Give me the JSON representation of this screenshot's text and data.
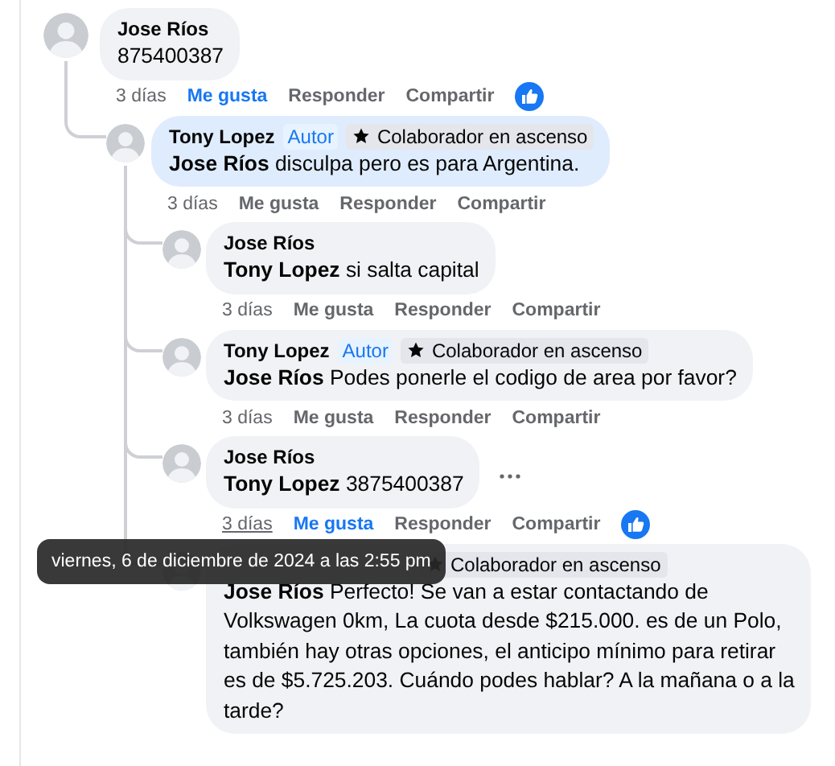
{
  "comments": [
    {
      "author": "Jose Ríos",
      "text": "875400387",
      "time": "3 días",
      "time_hovered": false,
      "actions": [
        "Me gusta",
        "Responder",
        "Compartir"
      ],
      "liked": true,
      "reaction": true,
      "replies": [
        {
          "author": "Tony Lopez",
          "author_tag": "Autor",
          "badge": "Colaborador en ascenso",
          "highlighted": true,
          "text": "**Jose Ríos** disculpa pero es para Argentina.",
          "time": "3 días",
          "time_hovered": false,
          "actions": [
            "Me gusta",
            "Responder",
            "Compartir"
          ],
          "liked": false,
          "replies": [
            {
              "author": "Jose Ríos",
              "text": "**Tony Lopez** si salta capital",
              "time": "3 días",
              "time_hovered": false,
              "actions": [
                "Me gusta",
                "Responder",
                "Compartir"
              ],
              "liked": false
            },
            {
              "author": "Tony Lopez",
              "author_tag": "Autor",
              "badge": "Colaborador en ascenso",
              "text": "**Jose Ríos** Podes ponerle el codigo de area por favor?",
              "time": "3 días",
              "time_hovered": false,
              "actions": [
                "Me gusta",
                "Responder",
                "Compartir"
              ],
              "liked": false
            },
            {
              "author": "Jose Ríos",
              "text": "**Tony Lopez** 3875400387",
              "time": "3 días",
              "time_hovered": true,
              "tooltip": "viernes, 6 de diciembre de 2024 a las 2:55 pm",
              "actions": [
                "Me gusta",
                "Responder",
                "Compartir"
              ],
              "liked": true,
              "reaction": true,
              "more_menu": true
            },
            {
              "badge": "Colaborador en ascenso",
              "header_covered": true,
              "text": "**Jose Ríos** Perfecto! Se van a estar contactando de Volkswagen 0km, La cuota desde $215.000. es de un Polo, también hay otras opciones, el anticipo mínimo para retirar es de $5.725.203. Cuándo podes hablar? A la mañana o a la tarde?"
            }
          ]
        }
      ]
    }
  ]
}
